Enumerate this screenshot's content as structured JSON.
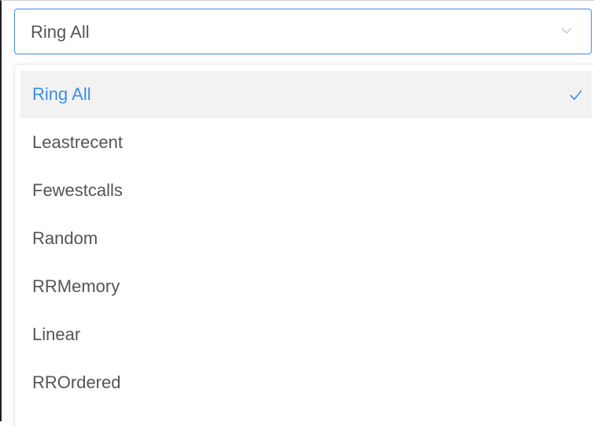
{
  "select": {
    "value": "Ring All",
    "arrow_icon": "chevron-down-icon"
  },
  "dropdown": {
    "options": [
      {
        "label": "Ring All",
        "selected": true
      },
      {
        "label": "Leastrecent",
        "selected": false
      },
      {
        "label": "Fewestcalls",
        "selected": false
      },
      {
        "label": "Random",
        "selected": false
      },
      {
        "label": "RRMemory",
        "selected": false
      },
      {
        "label": "Linear",
        "selected": false
      },
      {
        "label": "RROrdered",
        "selected": false
      }
    ],
    "selected_icon": "checkmark-icon"
  },
  "colors": {
    "accent": "#3d8fe0",
    "focus_border": "#4a90e2",
    "text": "#555555",
    "selected_bg": "#f2f2f2"
  }
}
